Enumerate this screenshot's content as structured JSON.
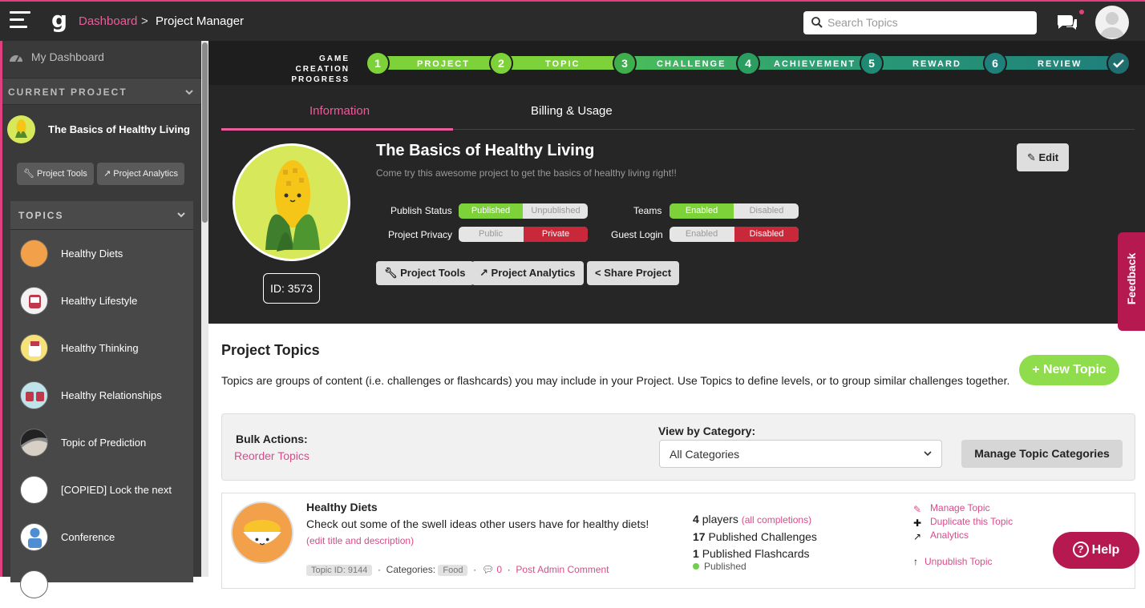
{
  "header": {
    "breadcrumb_dashboard": "Dashboard",
    "breadcrumb_separator": ">",
    "breadcrumb_current": "Project Manager",
    "search_placeholder": "Search Topics"
  },
  "sidebar": {
    "my_dashboard": "My Dashboard",
    "current_project_heading": "CURRENT PROJECT",
    "current_project_name": "The Basics of Healthy Living",
    "project_tools": "Project Tools",
    "project_analytics": "Project Analytics",
    "topics_heading": "TOPICS",
    "topics": [
      {
        "label": "Healthy Diets"
      },
      {
        "label": "Healthy Lifestyle"
      },
      {
        "label": "Healthy Thinking"
      },
      {
        "label": "Healthy Relationships"
      },
      {
        "label": "Topic of Prediction"
      },
      {
        "label": "[COPIED] Lock the next"
      },
      {
        "label": "Conference"
      }
    ]
  },
  "progress": {
    "heading_line1": "GAME CREATION",
    "heading_line2": "PROGRESS",
    "steps": [
      {
        "num": "1",
        "label": "PROJECT"
      },
      {
        "num": "2",
        "label": "TOPIC"
      },
      {
        "num": "3",
        "label": "CHALLENGE"
      },
      {
        "num": "4",
        "label": "ACHIEVEMENT"
      },
      {
        "num": "5",
        "label": "REWARD"
      },
      {
        "num": "6",
        "label": "REVIEW"
      }
    ]
  },
  "project": {
    "tab_information": "Information",
    "tab_billing": "Billing & Usage",
    "title": "The Basics of Healthy Living",
    "description": "Come try this awesome project to get the basics of healthy living right!!",
    "id_label": "ID: 3573",
    "edit": "Edit",
    "publish_status_label": "Publish Status",
    "publish_on": "Published",
    "publish_off": "Unpublished",
    "privacy_label": "Project Privacy",
    "privacy_public": "Public",
    "privacy_private": "Private",
    "teams_label": "Teams",
    "teams_enabled": "Enabled",
    "teams_disabled": "Disabled",
    "guest_label": "Guest Login",
    "guest_enabled": "Enabled",
    "guest_disabled": "Disabled",
    "btn_tools": "Project Tools",
    "btn_analytics": "Project Analytics",
    "btn_share": "Share Project"
  },
  "feedback": "Feedback",
  "topics_section": {
    "title": "Project Topics",
    "description": "Topics are groups of content (i.e. challenges or flashcards) you may include in your Project. Use Topics to define levels, or to group similar challenges together.",
    "new_topic": "+ New Topic",
    "bulk_actions": "Bulk Actions:",
    "reorder": "Reorder Topics",
    "view_by_category": "View by Category:",
    "category_selected": "All Categories",
    "manage_categories": "Manage Topic Categories"
  },
  "topic_card": {
    "name": "Healthy Diets",
    "description": "Check out some of the swell ideas other users have for healthy diets!",
    "edit_link": "(edit title and description)",
    "topic_id": "Topic ID: 9144",
    "categories_label": "Categories:",
    "category": "Food",
    "comments": "0",
    "post_comment": "Post Admin Comment",
    "players_count": "4",
    "players_label": "players",
    "all_completions": "(all completions)",
    "challenges_count": "17",
    "challenges_label": "Published Challenges",
    "flashcards_count": "1",
    "flashcards_label": "Published Flashcards",
    "status": "Published",
    "manage": "Manage Topic",
    "duplicate": "Duplicate this Topic",
    "analytics": "Analytics",
    "unpublish": "Unpublish Topic"
  },
  "help": "Help",
  "colors": {
    "accent_pink": "#e95d9a",
    "step_green": "#7dd23a",
    "step_teal": "#1f7f7a",
    "danger_red": "#c9283b"
  }
}
